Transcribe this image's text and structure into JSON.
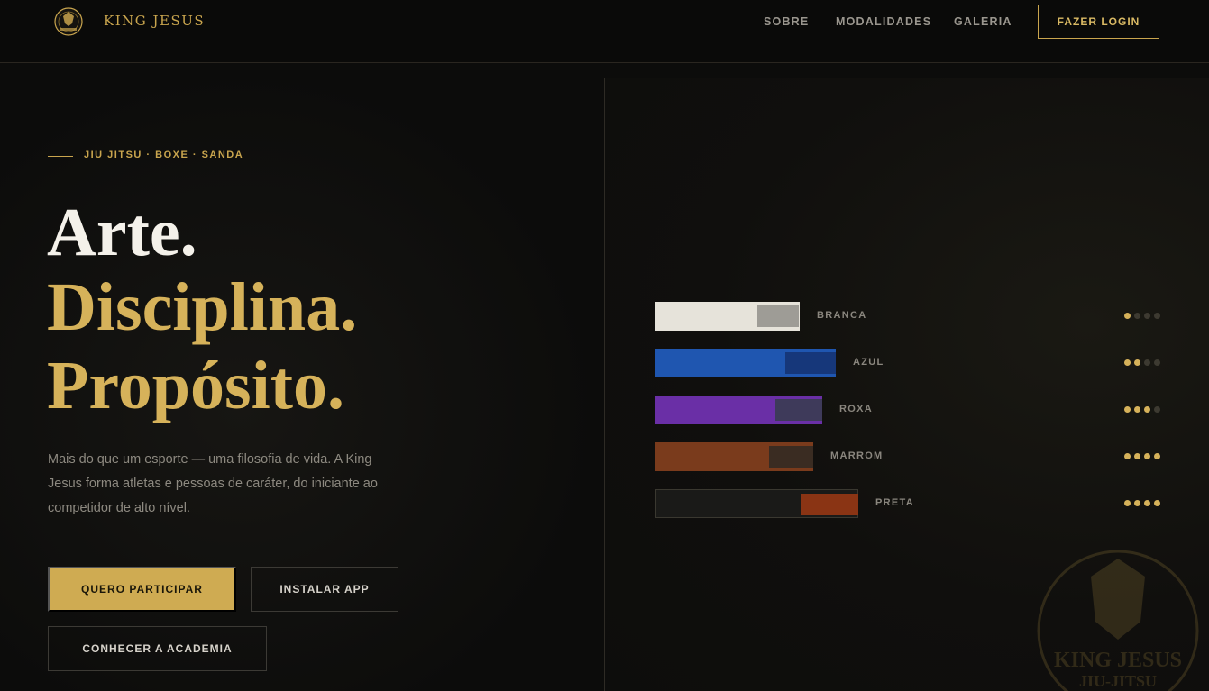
{
  "nav": {
    "brand": "KING JESUS",
    "links": [
      "SOBRE",
      "MODALIDADES",
      "GALERIA"
    ],
    "login": "FAZER LOGIN"
  },
  "hero": {
    "eyebrow": "JIU JITSU · BOXE · SANDA",
    "line1": "Arte.",
    "line2": "Disciplina.",
    "line3": "Propósito.",
    "description": "Mais do que um esporte — uma filosofia de vida. A King Jesus forma atletas e pessoas de caráter, do iniciante ao competidor de alto nível.",
    "primary_button": "QUERO PARTICIPAR",
    "app_button": "INSTALAR APP",
    "academy_button": "CONHECER A ACADEMIA"
  },
  "belts": [
    {
      "label": "BRANCA",
      "color": "#e6e3da",
      "tip": "#9e9c96",
      "level": 1
    },
    {
      "label": "AZUL",
      "color": "#1f56b0",
      "tip": "#16377a",
      "level": 2
    },
    {
      "label": "ROXA",
      "color": "#6a2fa6",
      "tip": "#3e3a5a",
      "level": 3
    },
    {
      "label": "MARROM",
      "color": "#7a3b1c",
      "tip": "#3a2c22",
      "level": 4
    },
    {
      "label": "PRETA",
      "color": "#1a1a18",
      "tip": "#8a3414",
      "level": 4
    }
  ],
  "watermark": {
    "line1": "KING JESUS",
    "line2": "JIU-JITSU"
  },
  "colors": {
    "accent": "#cfab52",
    "background": "#0c0c0b"
  }
}
